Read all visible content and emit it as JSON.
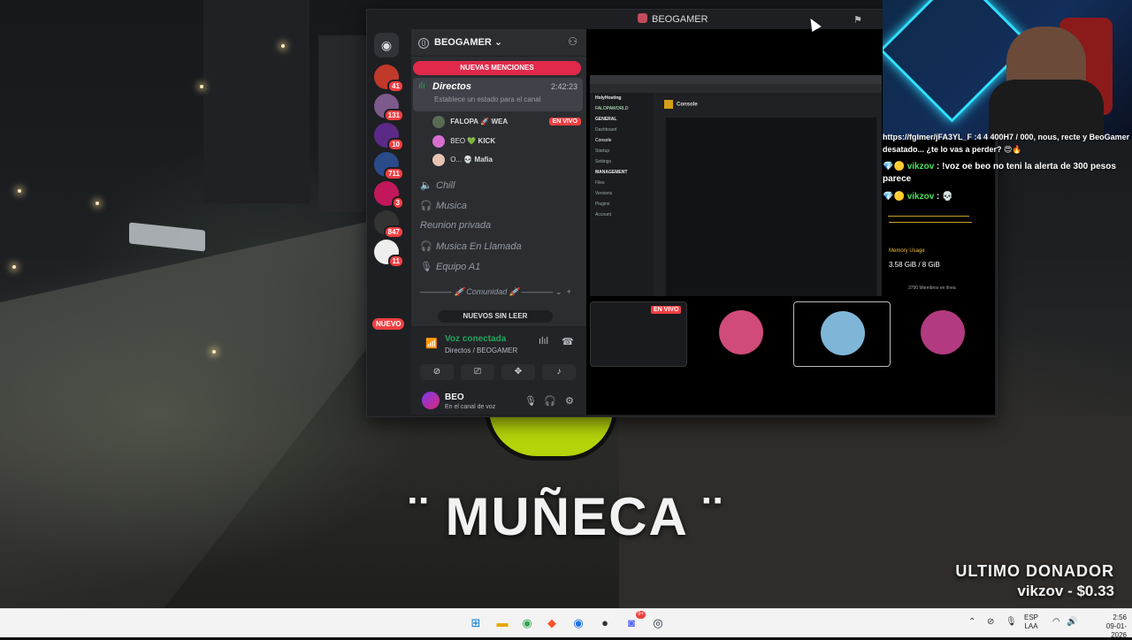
{
  "window": {
    "title": "BEOGAMER"
  },
  "servers": [
    {
      "badge": "41",
      "color": "#c0392b"
    },
    {
      "badge": "131",
      "color": "#7d5a8c"
    },
    {
      "badge": "10",
      "color": "#5b2a86"
    },
    {
      "badge": "711",
      "color": "#2a4a8a"
    },
    {
      "badge": "3",
      "color": "#c2185b"
    },
    {
      "badge": "847",
      "color": "#333333"
    },
    {
      "badge": "11",
      "color": "#eeeeee"
    }
  ],
  "servers_nuevo": "NUEVO",
  "guild": {
    "name": "BEOGAMER",
    "new_mentions": "NUEVAS MENCIONES",
    "active_channel": {
      "name": "Directos",
      "time": "2:42:23",
      "status": "Establece un estado para el canal"
    },
    "voice_users": [
      {
        "name": "FALOPA",
        "tag": "WEA",
        "live": "EN VIVO"
      },
      {
        "name": "BEO",
        "tag": "KICK"
      },
      {
        "name": "O...",
        "tag": "Mafia"
      }
    ],
    "channels": [
      {
        "icon": "speaker",
        "name": "Chill"
      },
      {
        "icon": "headphones",
        "name": "Musica"
      },
      {
        "icon": "none",
        "name": "Reunion privada"
      },
      {
        "icon": "headphones",
        "name": "Musica En Llamada"
      },
      {
        "icon": "mic",
        "name": "Equipo A1"
      }
    ],
    "category": "Comunidad",
    "unread_pill": "NUEVOS SIN LEER"
  },
  "voice": {
    "status": "Voz conectada",
    "location": "Directos / BEOGAMER"
  },
  "user": {
    "name": "BEO",
    "status": "En el canal de voz"
  },
  "stream": {
    "panel_brand": "HolyHosting",
    "server_name": "FALOPAWORLD",
    "nav_section_general": "GENERAL",
    "nav_general": [
      "Dashboard",
      "Console",
      "Startup",
      "Settings"
    ],
    "nav_section_management": "MANAGEMENT",
    "nav_management": [
      "Files",
      "Versions",
      "Plugins"
    ],
    "account": "Account",
    "console_title": "Console",
    "memory_label": "Memory Usage",
    "memory_value": "3.58 GiB / 8 GiB",
    "members": "3790 Miembros en línea"
  },
  "tiles": {
    "live_label": "EN VIVO",
    "colors": [
      "#e9a7e9",
      "#e9a7e9",
      "#e6e0e0"
    ]
  },
  "chat": {
    "line0": "https://fglmer/jFA3YL_F :4 4 400H7 / 000, nous, recte y BeoGamer desatado... ¿te lo vas a perder? 😍🔥",
    "msg1_user": "vikzov",
    "msg1_text": ": !voz oe beo no teni la alerta de 300 pesos parece",
    "msg2_user": "vikzov",
    "msg2_text": ":"
  },
  "overlay": {
    "song": "¨ MUÑECA ¨",
    "donor_label": "ULTIMO DONADOR",
    "donor_value": "vikzov - $0.33"
  },
  "taskbar": {
    "lang1": "ESP",
    "lang2": "LAA",
    "time": "2:56",
    "date": "09-01-2026",
    "discord_badge": "9+"
  }
}
